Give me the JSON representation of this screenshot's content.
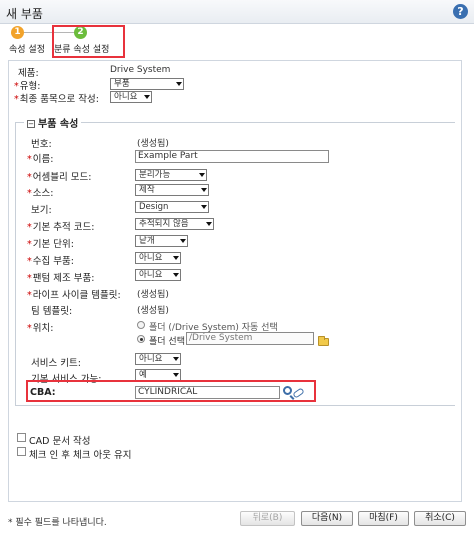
{
  "window": {
    "title": "새 부품",
    "help_icon": "help-icon"
  },
  "steps": [
    {
      "number": "1",
      "label": "속성 설정",
      "color": "#f2a32b"
    },
    {
      "number": "2",
      "label": "분류 속성 설정",
      "color": "#6cbd3c"
    }
  ],
  "top_fields": {
    "product_label": "제품:",
    "product_value": "Drive System",
    "type_label": "유형:",
    "type_value": "부품",
    "endItem_label": "최종 품목으로 작성:",
    "endItem_value": "아니요"
  },
  "section": {
    "title": "부품 속성",
    "number_label": "번호:",
    "number_value": "(생성됨)",
    "name_label": "이름:",
    "name_value": "Example Part",
    "assembly_label": "어셈블리 모드:",
    "assembly_value": "분리가능",
    "source_label": "소스:",
    "source_value": "제작",
    "view_label": "보기:",
    "view_value": "Design",
    "trace_label": "기본 추적 코드:",
    "trace_value": "추적되지 않음",
    "unit_label": "기본 단위:",
    "unit_value": "낱개",
    "collect_label": "수집 부품:",
    "collect_value": "아니요",
    "phantom_label": "팬텀 제조 부품:",
    "phantom_value": "아니요",
    "lifecycle_label": "라이프 사이클 템플릿:",
    "lifecycle_value": "(생성됨)",
    "team_label": "팀 템플릿:",
    "team_value": "(생성됨)",
    "location_label": "위치:",
    "location_auto": "폴더 (/Drive System) 자동 선택",
    "location_select": "폴더 선택",
    "location_path": "/Drive System",
    "service_label": "서비스 키트:",
    "service_value": "아니요",
    "serviceable_label": "기본 서비스 가능:",
    "serviceable_value": "예",
    "cba_label": "CBA:",
    "cba_value": "CYLINDRICAL"
  },
  "checkboxes": {
    "cad": "CAD 문서 작성",
    "checkin": "체크 인 후 체크 아웃 유지"
  },
  "footer": {
    "required_note": "* 필수 필드를 나타냅니다.",
    "back": "뒤로(B)",
    "next": "다음(N)",
    "finish": "마침(F)",
    "cancel": "취소(C)"
  },
  "colors": {
    "highlight": "#e8323c",
    "required": "#cc0000"
  }
}
